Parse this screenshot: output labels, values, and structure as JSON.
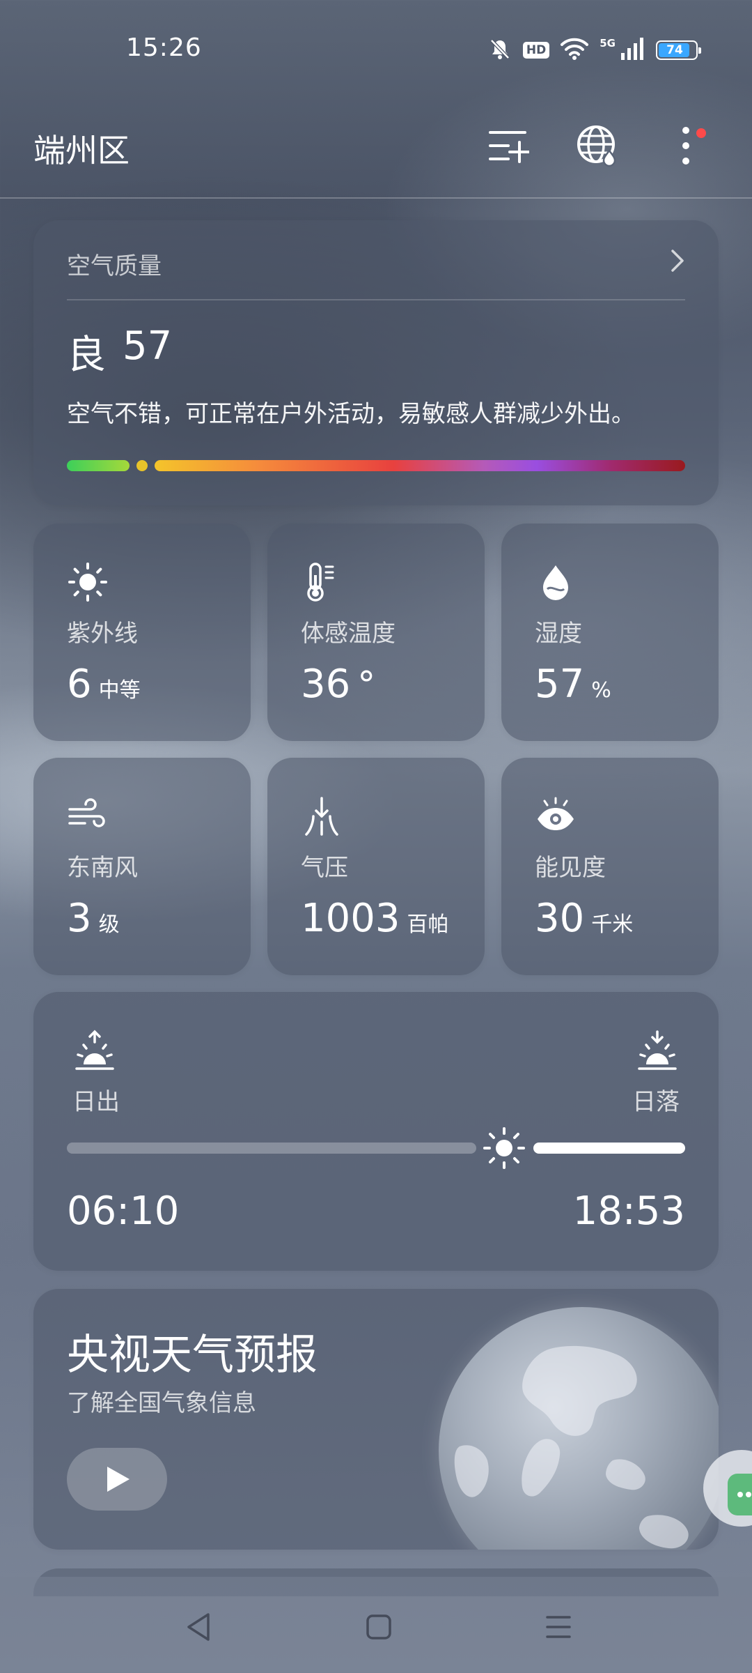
{
  "status_bar": {
    "time": "15:26",
    "icons": [
      "bell-muted-icon",
      "hd-badge",
      "wifi-icon",
      "5g-signal-icon",
      "battery-icon"
    ],
    "hd_label": "HD",
    "network_label": "5G",
    "battery_level": "74"
  },
  "header": {
    "location": "端州区",
    "actions": [
      "city-list-add-icon",
      "globe-icon",
      "more-icon"
    ]
  },
  "air_quality": {
    "title": "空气质量",
    "grade": "良",
    "aqi": "57",
    "description": "空气不错，可正常在户外活动，易敏感人群减少外出。",
    "colors": {
      "good": "#3ccf5a",
      "marker": "#e8c32a",
      "severe": "#9a1a1e"
    }
  },
  "tiles": [
    {
      "icon": "sun-icon",
      "label": "紫外线",
      "value": "6",
      "unit": "中等"
    },
    {
      "icon": "thermometer-icon",
      "label": "体感温度",
      "value": "36",
      "unit": "°"
    },
    {
      "icon": "droplet-icon",
      "label": "湿度",
      "value": "57",
      "unit": "%"
    },
    {
      "icon": "wind-icon",
      "label": "东南风",
      "value": "3",
      "unit": "级"
    },
    {
      "icon": "pressure-icon",
      "label": "气压",
      "value": "1003",
      "unit": "百帕"
    },
    {
      "icon": "eye-icon",
      "label": "能见度",
      "value": "30",
      "unit": "千米"
    }
  ],
  "sun": {
    "sunrise_label": "日出",
    "sunset_label": "日落",
    "sunrise_time": "06:10",
    "sunset_time": "18:53"
  },
  "tv": {
    "title": "央视天气预报",
    "subtitle": "了解全国气象信息"
  },
  "nav": [
    "back-icon",
    "home-icon",
    "menu-icon"
  ]
}
